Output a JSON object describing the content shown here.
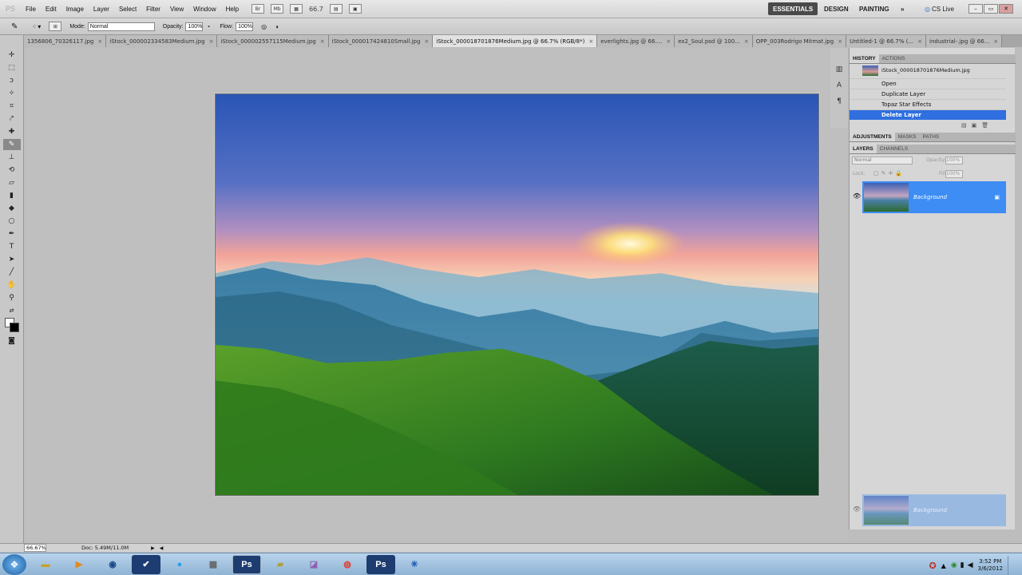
{
  "app": {
    "logo": "PS"
  },
  "menu": [
    "File",
    "Edit",
    "Image",
    "Layer",
    "Select",
    "Filter",
    "View",
    "Window",
    "Help"
  ],
  "menubar": {
    "br_icon": "Br",
    "mb_icon": "Mb",
    "zoom": "66.7"
  },
  "workspaces": {
    "essentials": "ESSENTIALS",
    "design": "DESIGN",
    "painting": "PAINTING",
    "more": "»",
    "cslive": "CS Live"
  },
  "options": {
    "mode_label": "Mode:",
    "mode_value": "Normal",
    "opacity_label": "Opacity:",
    "opacity_value": "100%",
    "flow_label": "Flow:",
    "flow_value": "100%"
  },
  "tabs": [
    {
      "label": "1356806_70326117.jpg"
    },
    {
      "label": "iStock_000002334583Medium.jpg"
    },
    {
      "label": "iStock_000002557115Medium.jpg"
    },
    {
      "label": "iStock_000017424810Small.jpg"
    },
    {
      "label": "iStock_000018701876Medium.jpg @ 66.7% (RGB/8*)"
    },
    {
      "label": "everlights.jpg @ 66...."
    },
    {
      "label": "ex2_Soul.psd @ 100..."
    },
    {
      "label": "OPP_003Rodrigo Mitmat.jpg"
    },
    {
      "label": "Untitled-1 @ 66.7% (..."
    },
    {
      "label": "industrial-.jpg @ 66..."
    }
  ],
  "history": {
    "tabs": {
      "history": "HISTORY",
      "actions": "ACTIONS"
    },
    "snapshot": "iStock_000018701876Medium.jpg",
    "states": [
      "Open",
      "Duplicate Layer",
      "Topaz Star Effects",
      "Delete Layer"
    ]
  },
  "adjust_tabs": {
    "adjustments": "ADJUSTMENTS",
    "masks": "MASKS",
    "paths": "PATHS"
  },
  "layers": {
    "tabs": {
      "layers": "LAYERS",
      "channels": "CHANNELS"
    },
    "blend": "Normal",
    "opacity_label": "Opacity:",
    "opacity": "100%",
    "lock_label": "Lock:",
    "fill_label": "Fill:",
    "fill": "100%",
    "layer_name": "Background",
    "ghost_name": "Background"
  },
  "status": {
    "zoom": "66.67%",
    "doc": "Doc: 5.49M/11.0M"
  },
  "taskbar": {
    "time": "3:52 PM",
    "date": "3/6/2012"
  },
  "colors": {
    "selection": "#2f6fe0",
    "layer_highlight": "#3d8df5"
  }
}
